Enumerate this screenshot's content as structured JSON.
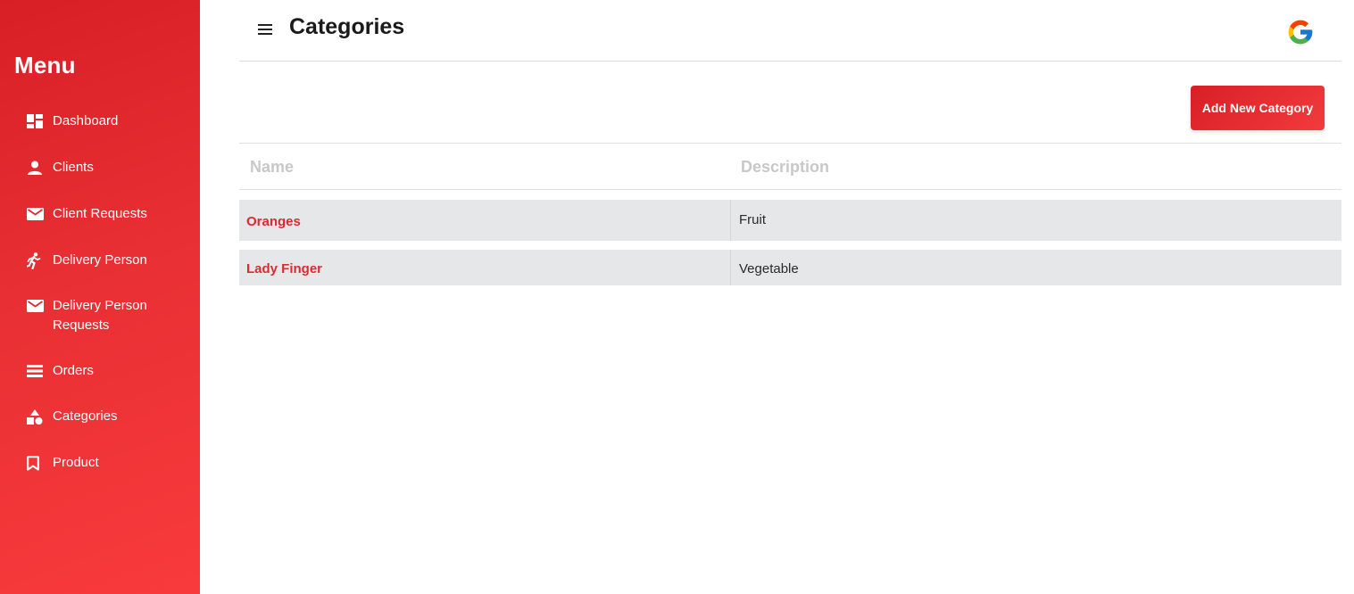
{
  "sidebar": {
    "title": "Menu",
    "items": [
      {
        "label": "Dashboard",
        "icon": "dashboard-icon"
      },
      {
        "label": "Clients",
        "icon": "user-icon"
      },
      {
        "label": "Client Requests",
        "icon": "mail-icon"
      },
      {
        "label": "Delivery Person",
        "icon": "running-person-icon"
      },
      {
        "label": "Delivery Person\nRequests",
        "icon": "mail-icon"
      },
      {
        "label": "Orders",
        "icon": "list-icon"
      },
      {
        "label": "Categories",
        "icon": "shapes-icon"
      },
      {
        "label": "Product",
        "icon": "bookmark-icon"
      }
    ]
  },
  "header": {
    "title": "Categories",
    "menu_icon": "hamburger-icon",
    "account_icon": "google-icon"
  },
  "toolbar": {
    "add_label": "Add New Category"
  },
  "table": {
    "columns": [
      "Name",
      "Description"
    ],
    "rows": [
      {
        "name": "Oranges",
        "description": "Fruit"
      },
      {
        "name": "Lady Finger",
        "description": "Vegetable"
      }
    ]
  },
  "colors": {
    "accent": "#e12a30",
    "row_background": "#e6e7e9",
    "header_text": "#c8c8c8"
  }
}
